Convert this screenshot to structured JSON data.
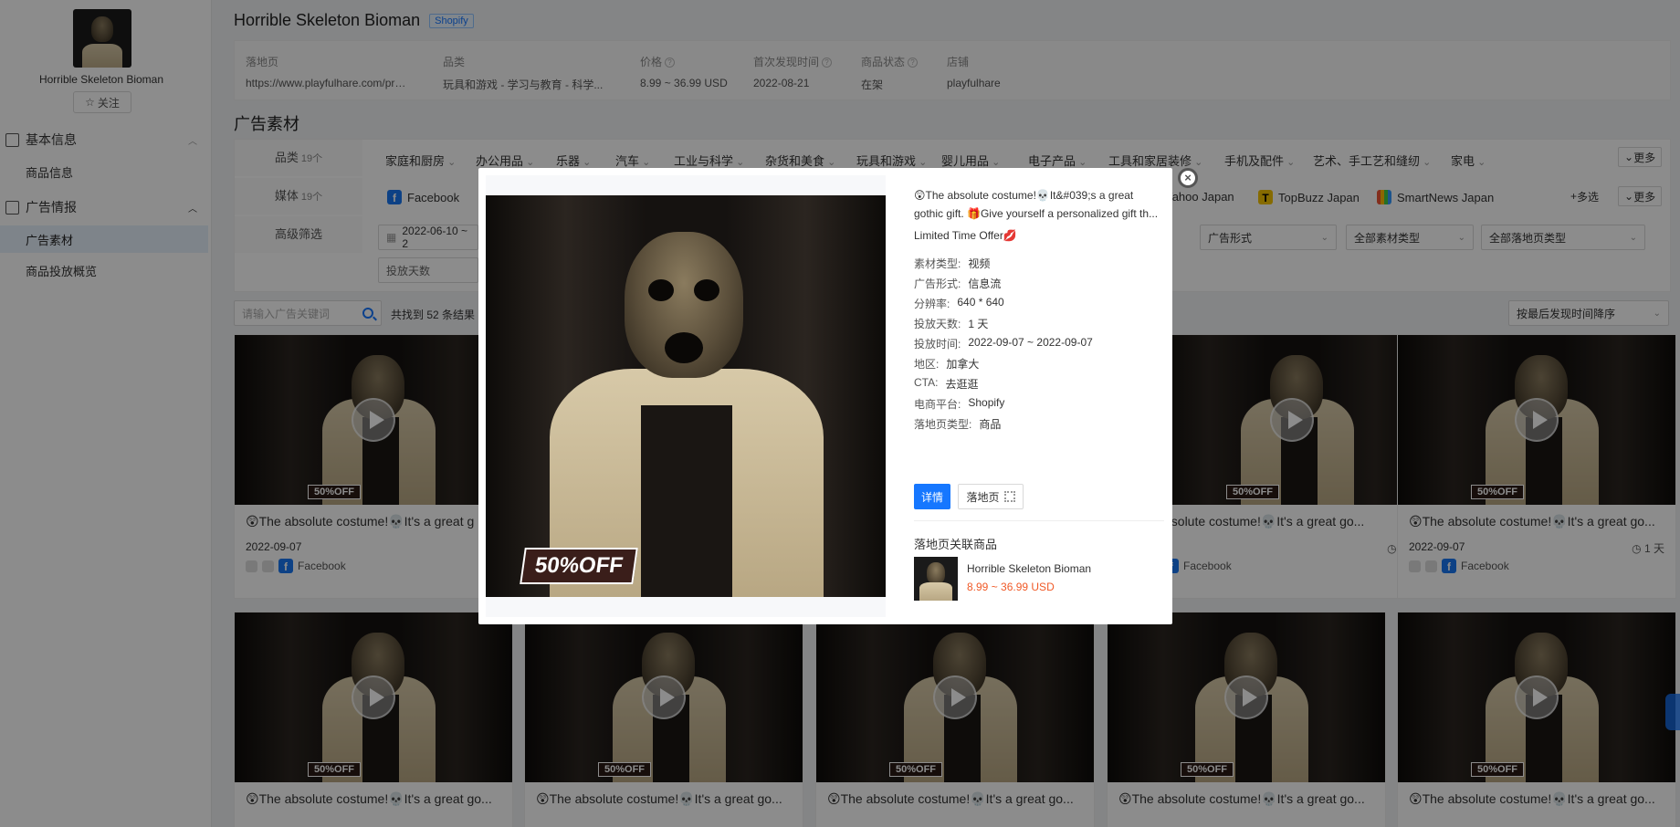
{
  "sidebar": {
    "product_name": "Horrible Skeleton Bioman",
    "follow_label": "关注",
    "groups": [
      {
        "label": "基本信息",
        "items": [
          {
            "label": "商品信息"
          }
        ]
      },
      {
        "label": "广告情报",
        "items": [
          {
            "label": "广告素材"
          },
          {
            "label": "商品投放概览"
          }
        ]
      }
    ]
  },
  "header": {
    "title": "Horrible Skeleton Bioman",
    "platform_tag": "Shopify"
  },
  "info": {
    "landing_label": "落地页",
    "landing_value": "https://www.playfulhare.com/pro...",
    "category_label": "品类",
    "category_value": "玩具和游戏 - 学习与教育 - 科学...",
    "price_label": "价格",
    "price_value": "8.99 ~ 36.99 USD",
    "first_seen_label": "首次发现时间",
    "first_seen_value": "2022-08-21",
    "status_label": "商品状态",
    "status_value": "在架",
    "store_label": "店铺",
    "store_value": "playfulhare"
  },
  "section_title": "广告素材",
  "filters": {
    "category_label": "品类",
    "category_count": "19个",
    "categories": [
      "家庭和厨房",
      "办公用品",
      "乐器",
      "汽车",
      "工业与科学",
      "杂货和美食",
      "玩具和游戏",
      "婴儿用品",
      "电子产品",
      "工具和家居装修",
      "手机及配件",
      "艺术、手工艺和缝纫",
      "家电"
    ],
    "more_label": "更多",
    "media_label": "媒体",
    "media_count": "19个",
    "media": [
      "Facebook",
      "Yahoo Japan",
      "TopBuzz Japan",
      "SmartNews Japan"
    ],
    "multi_label": "多选",
    "advanced_label": "高级筛选",
    "date_range": "2022-06-10 ~ 2",
    "days_placeholder": "投放天数",
    "ad_form": "广告形式",
    "material_type": "全部素材类型",
    "landing_type": "全部落地页类型"
  },
  "toolbar": {
    "search_placeholder": "请输入广告关键词",
    "result_text": "共找到 52 条结果",
    "sort_label": "按最后发现时间降序"
  },
  "cards": {
    "title": "😲The absolute costume!💀It's a great go...",
    "title_short": "😲The absolute costume!💀It's a great g",
    "title_cut": "bsolute costume!💀It's a great go...",
    "date": "2022-09-07",
    "days": "1 天",
    "platform": "Facebook",
    "off_badge": "50%OFF"
  },
  "modal": {
    "desc_line1": "😲The absolute costume!💀It&#039;s a great",
    "desc_line2": "gothic gift. 🎁Give yourself a personalized gift th...",
    "desc_line3": "Limited Time Offer💋",
    "attrs": [
      {
        "k": "素材类型:",
        "v": "视频"
      },
      {
        "k": "广告形式:",
        "v": "信息流"
      },
      {
        "k": "分辨率:",
        "v": "640 * 640"
      },
      {
        "k": "投放天数:",
        "v": "1 天"
      },
      {
        "k": "投放时间:",
        "v": "2022-09-07 ~ 2022-09-07"
      },
      {
        "k": "地区:",
        "v": "加拿大"
      },
      {
        "k": "CTA:",
        "v": "去逛逛"
      },
      {
        "k": "电商平台:",
        "v": "Shopify"
      },
      {
        "k": "落地页类型:",
        "v": "商品"
      }
    ],
    "detail_btn": "详情",
    "landing_btn": "落地页",
    "related_title": "落地页关联商品",
    "related_name": "Horrible Skeleton Bioman",
    "related_price": "8.99 ~ 36.99 USD",
    "off_badge": "50%OFF",
    "close_glyph": "×"
  },
  "colors": {
    "accent": "#1677ff",
    "price": "#f05a28",
    "facebook": "#1877f2"
  }
}
